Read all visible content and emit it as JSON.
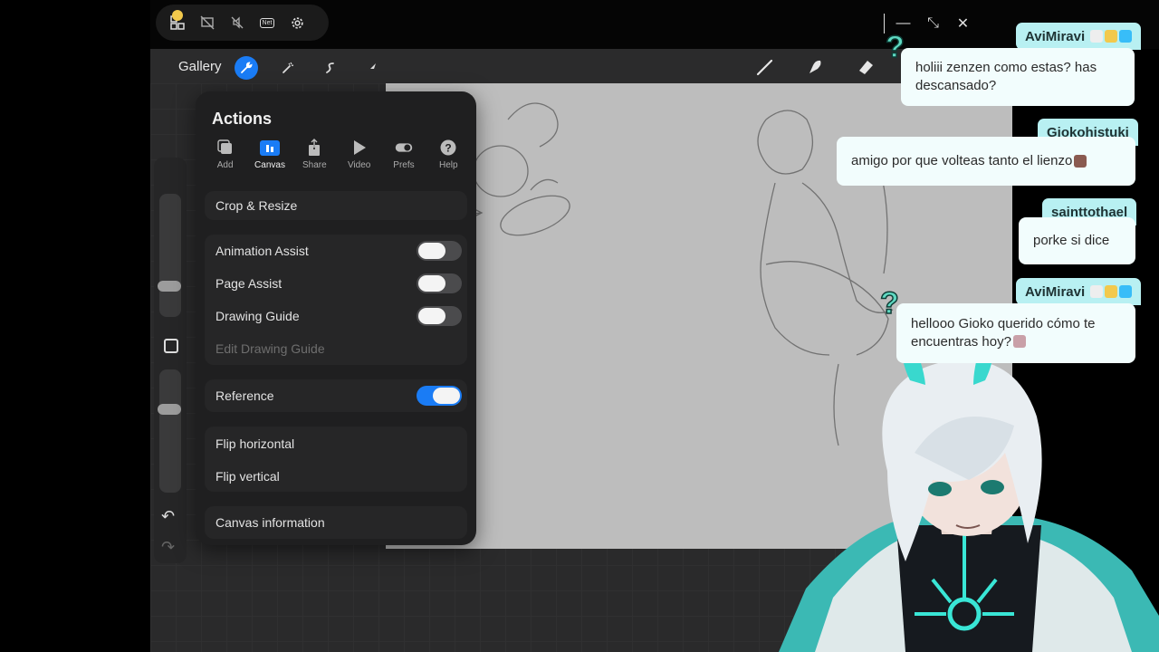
{
  "mirror": {
    "icons": [
      "qr-icon",
      "screen-off-icon",
      "mute-icon",
      "network-icon",
      "gear-icon"
    ],
    "network_label": "Net",
    "window": {
      "minimize": "—",
      "shrink": "⤡",
      "close": "✕"
    }
  },
  "procreate": {
    "gallery": "Gallery",
    "left_tools": [
      "wrench-icon",
      "adjust-icon",
      "selection-icon",
      "transform-icon"
    ],
    "right_tools": [
      "brush-icon",
      "smudge-icon",
      "eraser-icon"
    ],
    "accent": "#1a7cf5",
    "actions": {
      "title": "Actions",
      "tabs": [
        {
          "label": "Add",
          "icon": "add-icon"
        },
        {
          "label": "Canvas",
          "icon": "canvas-icon",
          "active": true
        },
        {
          "label": "Share",
          "icon": "share-icon"
        },
        {
          "label": "Video",
          "icon": "play-icon"
        },
        {
          "label": "Prefs",
          "icon": "toggle-icon"
        },
        {
          "label": "Help",
          "icon": "help-icon"
        }
      ],
      "crop": "Crop & Resize",
      "animation_assist": {
        "label": "Animation Assist",
        "on": false
      },
      "page_assist": {
        "label": "Page Assist",
        "on": false
      },
      "drawing_guide": {
        "label": "Drawing Guide",
        "on": false
      },
      "edit_drawing_guide": "Edit Drawing Guide",
      "reference": {
        "label": "Reference",
        "on": true
      },
      "flip_h": "Flip horizontal",
      "flip_v": "Flip vertical",
      "canvas_info": "Canvas information"
    }
  },
  "chat": [
    {
      "user": "AviMiravi",
      "message_line1": "holiii zenzen como estas? has",
      "message_line2": "descansado?"
    },
    {
      "user": "Giokohistuki",
      "message_line1": "amigo por que volteas tanto el lienzo"
    },
    {
      "user": "sainttothael",
      "message_line1": "porke si dice"
    },
    {
      "user": "AviMiravi",
      "message_line1": "hellooo Gioko querido cómo te",
      "message_line2": "encuentras hoy?"
    }
  ]
}
